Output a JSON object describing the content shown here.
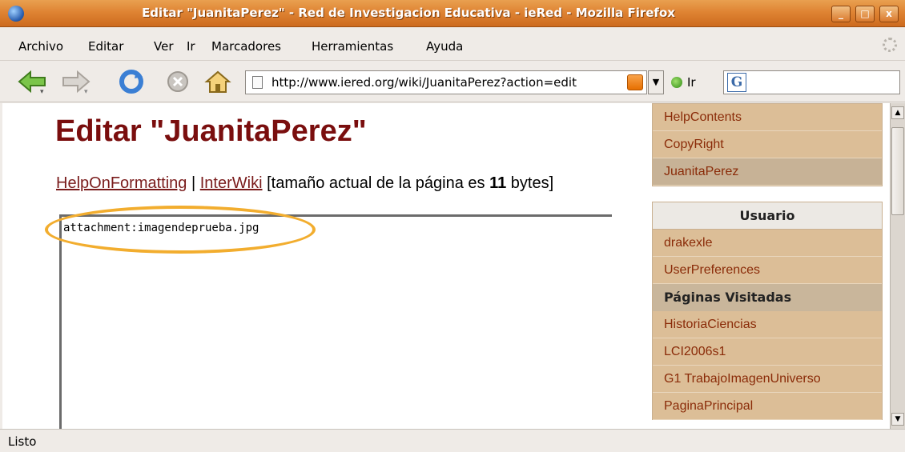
{
  "window": {
    "title": "Editar \"JuanitaPerez\" - Red de Investigacion Educativa - ieRed - Mozilla Firefox",
    "minimize": "_",
    "maximize": "□",
    "close": "x"
  },
  "menu": [
    "Archivo",
    "Editar",
    "Ver",
    "Ir",
    "Marcadores",
    "Herramientas",
    "Ayuda"
  ],
  "nav": {
    "url": "http://www.iered.org/wiki/JuanitaPerez?action=edit",
    "go_label": "Ir",
    "search_engine": "G"
  },
  "page": {
    "title": "Editar \"JuanitaPerez\"",
    "help_link1": "HelpOnFormatting",
    "separator": "|",
    "help_link2": "InterWiki",
    "size_prefix": "[tamaño actual de la página es",
    "size_value": "11",
    "size_suffix": "bytes]",
    "editor_text": "attachment:imagendeprueba.jpg"
  },
  "sidebar": {
    "nav_items": [
      "HelpContents",
      "CopyRight",
      "JuanitaPerez"
    ],
    "user_header": "Usuario",
    "user_items": [
      "drakexle",
      "UserPreferences"
    ],
    "visited_header": "Páginas Visitadas",
    "visited_items": [
      "HistoriaCiencias",
      "LCI2006s1",
      "G1 TrabajoImagenUniverso",
      "PaginaPrincipal"
    ]
  },
  "status": "Listo",
  "colors": {
    "titlebar": "#df8433",
    "page_title": "#7a0e0e",
    "link": "#7a1c1c",
    "sidebar_item_bg": "#dcbe97",
    "highlight_ring": "#f2ad2e"
  }
}
